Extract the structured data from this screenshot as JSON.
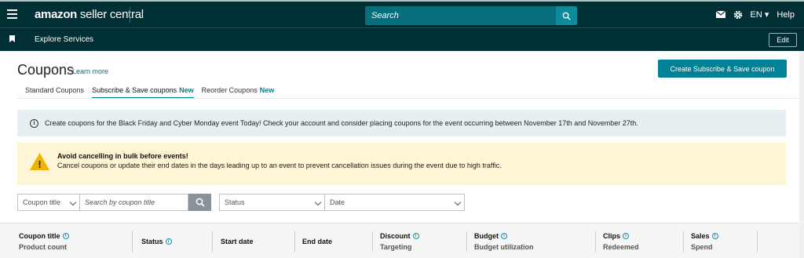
{
  "topbar": {
    "logo_bold": "amazon",
    "logo_rest": " seller central",
    "search_placeholder": "Search",
    "language": "EN",
    "help": "Help"
  },
  "nav2": {
    "explore": "Explore Services",
    "edit": "Edit"
  },
  "page": {
    "title": "Coupons",
    "learn_more": "Learn more",
    "create_button": "Create Subscribe & Save coupon"
  },
  "tabs": [
    {
      "label": "Standard Coupons",
      "new": ""
    },
    {
      "label": "Subscribe & Save coupons",
      "new": "New"
    },
    {
      "label": "Reorder Coupons",
      "new": "New"
    }
  ],
  "info_banner": "Create coupons for the Black Friday and Cyber Monday event Today! Check your account and consider placing coupons for the event occurring between November 17th and November 27th.",
  "warning": {
    "title": "Avoid cancelling in bulk before events!",
    "text": "Cancel coupons or update their end dates in the days leading up to an event to prevent cancellation issues during the event due to high traffic."
  },
  "filters": {
    "coupon_title": "Coupon title",
    "search_placeholder": "Search by coupon title",
    "status": "Status",
    "date": "Date"
  },
  "table_headers": [
    {
      "title": "Coupon title",
      "sub": "Product count"
    },
    {
      "title": "Status",
      "sub": ""
    },
    {
      "title": "Start date",
      "sub": ""
    },
    {
      "title": "End date",
      "sub": ""
    },
    {
      "title": "Discount",
      "sub": "Targeting"
    },
    {
      "title": "Budget",
      "sub": "Budget utilization"
    },
    {
      "title": "Clips",
      "sub": "Redeemed"
    },
    {
      "title": "Sales",
      "sub": "Spend"
    }
  ],
  "colors": {
    "topbar": "#002f36",
    "accent": "#008296",
    "info_bg": "#e6f0f3",
    "warn_bg": "#fdf5d6"
  }
}
